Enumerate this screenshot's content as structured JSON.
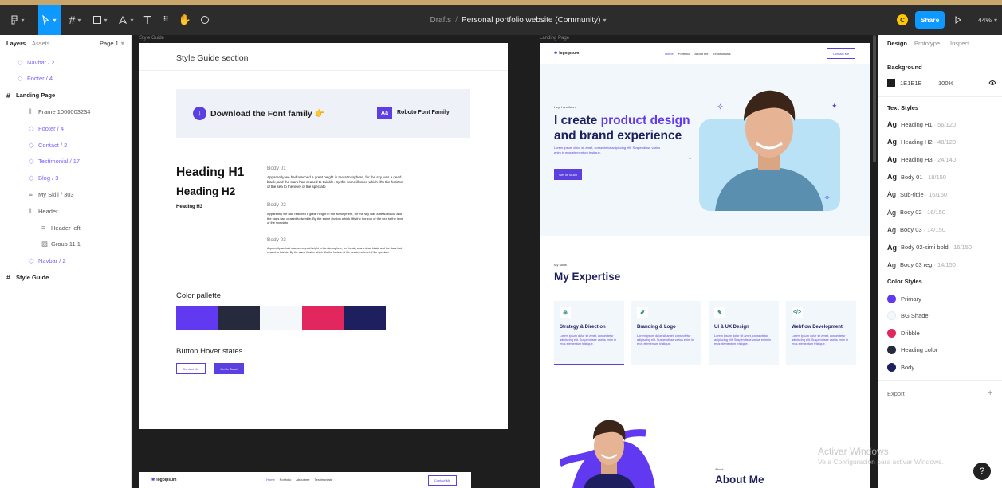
{
  "toolbar": {
    "breadcrumb_drafts": "Drafts",
    "breadcrumb_sep": "/",
    "file_name": "Personal portfolio website (Community)",
    "avatar_initial": "C",
    "share_label": "Share",
    "zoom": "44%"
  },
  "left_panel": {
    "tab_layers": "Layers",
    "tab_assets": "Assets",
    "page": "Page 1",
    "layers": [
      {
        "label": "Navbar / 2",
        "type": "component",
        "style": "purple"
      },
      {
        "label": "Footer / 4",
        "type": "component",
        "style": "purple"
      },
      {
        "label": "Landing Page",
        "type": "frame",
        "style": "bold"
      },
      {
        "label": "Frame 1000003234",
        "type": "auto-layout",
        "style": "gray"
      },
      {
        "label": "Footer / 4",
        "type": "component",
        "style": "purple"
      },
      {
        "label": "Contact / 2",
        "type": "component",
        "style": "purple"
      },
      {
        "label": "Testimonial / 17",
        "type": "component",
        "style": "purple"
      },
      {
        "label": "Blog / 3",
        "type": "component",
        "style": "purple"
      },
      {
        "label": "My Skill / 303",
        "type": "list",
        "style": "gray"
      },
      {
        "label": "Header",
        "type": "auto-layout",
        "style": "gray"
      },
      {
        "label": "Header left",
        "type": "list",
        "style": "gray"
      },
      {
        "label": "Group 11 1",
        "type": "image",
        "style": "gray"
      },
      {
        "label": "Navbar / 2",
        "type": "component",
        "style": "purple"
      },
      {
        "label": "Style Guide",
        "type": "frame",
        "style": "bold"
      }
    ]
  },
  "canvas": {
    "style_guide_label": "Style Guide",
    "landing_label": "Landing Page",
    "sg": {
      "section_title": "Style Guide section",
      "download_text": "Download the Font family",
      "aa": "Aa",
      "font_link": "Roboto Font Family",
      "h1": "Heading H1",
      "h2": "Heading H2",
      "h3": "Heading H3",
      "body01_label": "Body 01",
      "body01_text": "Apparently we had reached a great height in the atmosphere, for the sky was a dead black, and the stars had ceased to twinkle. By the same illusion which lifts the horizon of the sea to the level of the spectato",
      "body02_label": "Body 02",
      "body02_text": "Apparently we had reached a great height in the atmosphere, for the sky was a dead black, and the stars had ceased to twinkle. By the same illusion which lifts the horizon of the sea to the level of the spectato",
      "body03_label": "Body 03",
      "body03_text": "Apparently we had reached a great height in the atmosphere, for the sky was a dead black, and the stars had ceased to twinkle. By the same illusion which lifts the horizon of the sea to the level of the spectato",
      "palette_title": "Color pallette",
      "palette": [
        "#6039f0",
        "#272a3d",
        "#f4f8fb",
        "#e2275f",
        "#1e1f5e"
      ],
      "button_title": "Button Hover states",
      "btn_contact": "Contact Me",
      "btn_get": "Get In Touch"
    },
    "nav": {
      "logo": "logoipsum",
      "links": [
        "Home",
        "Portfolio",
        "About me",
        "Testimonials"
      ],
      "contact": "Contact Me"
    },
    "hero": {
      "hey": "Hey, I am John",
      "line1a": "I create ",
      "line1b": "product design",
      "line2": "and brand experience",
      "para": "Lorem ipsum dolor sit amet, consectetur adipiscing elit. Suspendisse varius enim in eros elementum tristique.",
      "button": "Get In Touch"
    },
    "skills": {
      "label": "My Skills",
      "title": "My Expertise",
      "cards": [
        {
          "title": "Strategy & Direction",
          "icon": "strategy-icon",
          "text": "Lorem ipsum dolor sit amet, consectetur adipiscing elit. Suspendisse varius enim in eros elementum tristique."
        },
        {
          "title": "Branding & Logo",
          "icon": "pen-icon",
          "text": "Lorem ipsum dolor sit amet, consectetur adipiscing elit. Suspendisse varius enim in eros elementum tristique."
        },
        {
          "title": "UI & UX Design",
          "icon": "feather-icon",
          "text": "Lorem ipsum dolor sit amet, consectetur adipiscing elit. Suspendisse varius enim in eros elementum tristique."
        },
        {
          "title": "Webflow Development",
          "icon": "code-icon",
          "text": "Lorem ipsum dolor sit amet, consectetur adipiscing elit. Suspendisse varius enim in eros elementum tristique."
        }
      ]
    },
    "about": {
      "label": "About",
      "title": "About Me"
    }
  },
  "right_panel": {
    "tab_design": "Design",
    "tab_prototype": "Prototype",
    "tab_inspect": "Inspect",
    "background_title": "Background",
    "bg_hex": "1E1E1E",
    "bg_opacity": "100%",
    "text_styles_title": "Text Styles",
    "text_styles": [
      {
        "name": "Heading H1",
        "spec": "56/120"
      },
      {
        "name": "Heading H2",
        "spec": "48/120"
      },
      {
        "name": "Heading H3",
        "spec": "24/140"
      },
      {
        "name": "Body 01",
        "spec": "18/150"
      },
      {
        "name": "Sub-tittle",
        "spec": "16/150"
      },
      {
        "name": "Body 02",
        "spec": "16/150"
      },
      {
        "name": "Body 03",
        "spec": "14/150"
      },
      {
        "name": "Body 02-simi bold",
        "spec": "16/150"
      },
      {
        "name": "Body 03 reg",
        "spec": "14/150"
      }
    ],
    "ag": "Ag",
    "color_styles_title": "Color Styles",
    "color_styles": [
      {
        "name": "Primary",
        "color": "#6039f0"
      },
      {
        "name": "BG Shade",
        "color": "#f4f8fb"
      },
      {
        "name": "Dribble",
        "color": "#e2275f"
      },
      {
        "name": "Heading color",
        "color": "#272a3d"
      },
      {
        "name": "Body",
        "color": "#1e1f5e"
      }
    ],
    "export_title": "Export",
    "export_plus": "+"
  },
  "activation": {
    "line1": "Activar Windows",
    "line2": "Ve a Configuración para activar Windows."
  },
  "help": "?"
}
